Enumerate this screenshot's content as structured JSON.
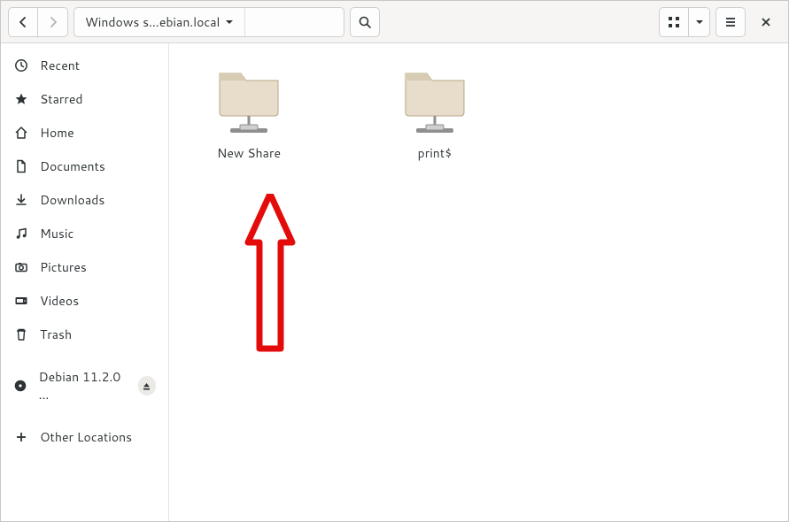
{
  "header": {
    "path_label": "Windows s…ebian.local"
  },
  "sidebar": {
    "items": [
      {
        "label": "Recent"
      },
      {
        "label": "Starred"
      },
      {
        "label": "Home"
      },
      {
        "label": "Documents"
      },
      {
        "label": "Downloads"
      },
      {
        "label": "Music"
      },
      {
        "label": "Pictures"
      },
      {
        "label": "Videos"
      },
      {
        "label": "Trash"
      },
      {
        "label": "Debian 11.2.0 …"
      },
      {
        "label": "Other Locations"
      }
    ]
  },
  "content": {
    "shares": [
      {
        "label": "New Share"
      },
      {
        "label": "print$"
      }
    ]
  }
}
